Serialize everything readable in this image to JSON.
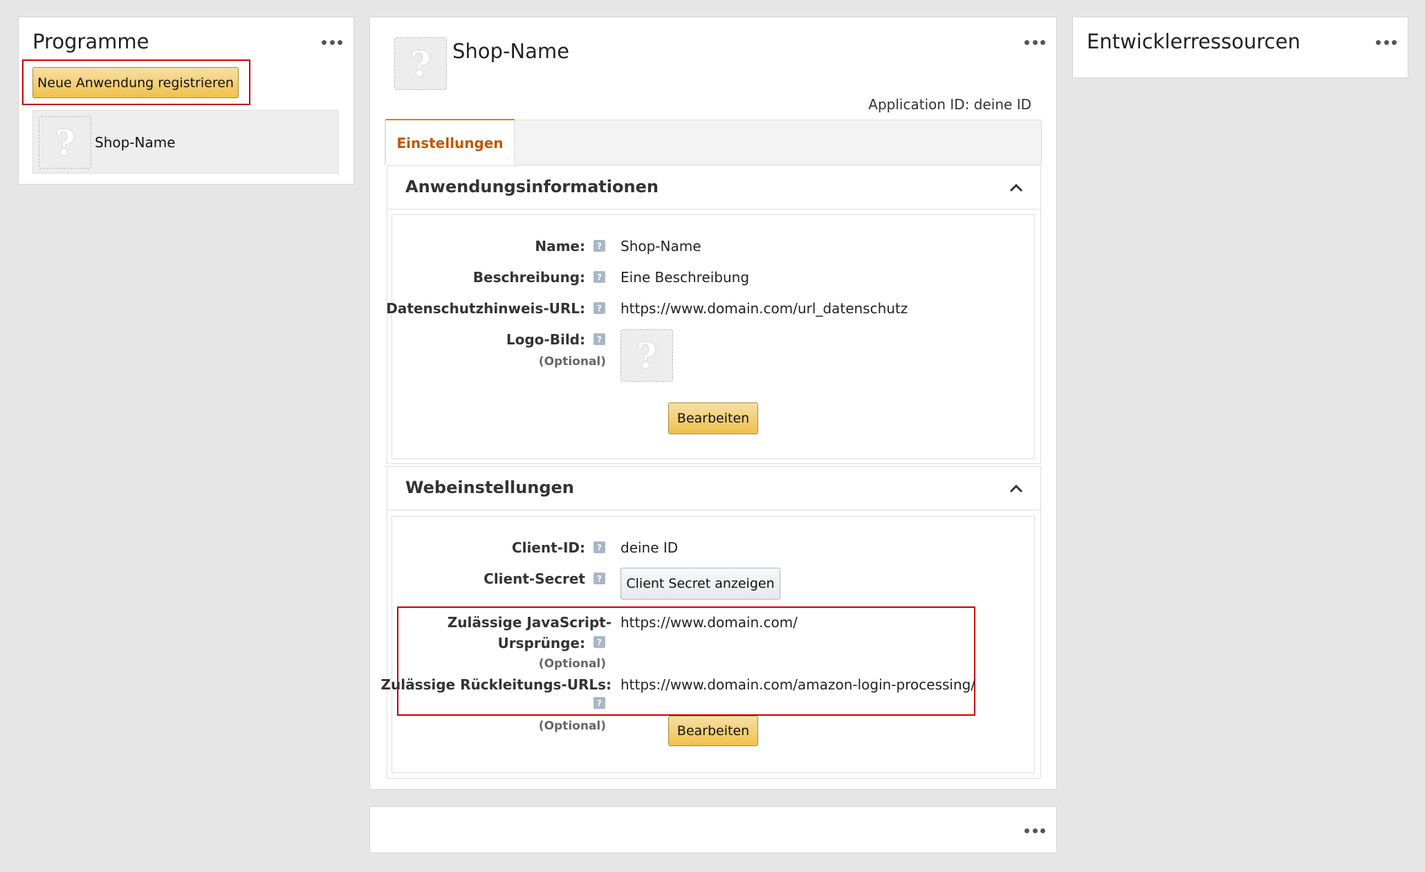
{
  "programs": {
    "title": "Programme",
    "register_button": "Neue Anwendung registrieren",
    "app_item_name": "Shop-Name"
  },
  "app": {
    "name": "Shop-Name",
    "application_id_label": "Application ID: deine ID",
    "tab_settings": "Einstellungen"
  },
  "app_info": {
    "title": "Anwendungsinformationen",
    "name_label": "Name:",
    "name_value": "Shop-Name",
    "description_label": "Beschreibung:",
    "description_value": "Eine Beschreibung",
    "privacy_label": "Datenschutzhinweis-URL:",
    "privacy_value": "https://www.domain.com/url_datenschutz",
    "logo_label": "Logo-Bild:",
    "optional": "(Optional)",
    "edit_button": "Bearbeiten"
  },
  "web_settings": {
    "title": "Webeinstellungen",
    "client_id_label": "Client-ID:",
    "client_id_value": "deine ID",
    "client_secret_label": "Client-Secret",
    "show_secret_button": "Client Secret anzeigen",
    "js_origins_label_line1": "Zulässige JavaScript-",
    "js_origins_label_line2": "Ursprünge:",
    "js_origins_value": "https://www.domain.com/",
    "optional": "(Optional)",
    "return_urls_label": "Zulässige Rückleitungs-URLs:",
    "return_urls_value": "https://www.domain.com/amazon-login-processing/",
    "edit_button": "Bearbeiten"
  },
  "dev_resources": {
    "title": "Entwicklerressourcen"
  },
  "help_glyph": "?",
  "placeholder_glyph": "?",
  "colors": {
    "accent": "#e47911",
    "tab_text": "#c45500",
    "highlight": "#c40000",
    "button_yellow": "#f0c14b"
  }
}
